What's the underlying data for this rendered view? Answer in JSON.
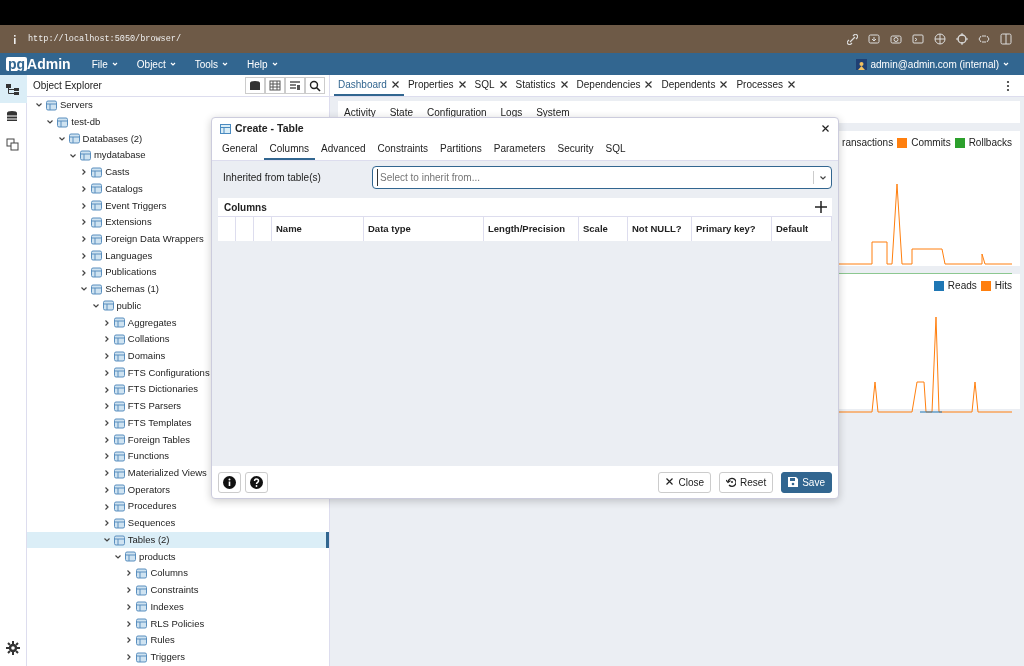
{
  "browser_bar": {
    "url": "http://localhost:5050/browser/"
  },
  "app": {
    "logo_prefix": "pg",
    "logo_rest": "Admin",
    "menus": [
      {
        "label": "File"
      },
      {
        "label": "Object"
      },
      {
        "label": "Tools"
      },
      {
        "label": "Help"
      }
    ],
    "user": "admin@admin.com (internal)"
  },
  "object_explorer": {
    "title": "Object Explorer",
    "tree": [
      {
        "label": "Servers",
        "expanded": true,
        "selected": false,
        "children": [
          {
            "label": "test-db",
            "expanded": true,
            "selected": false,
            "children": [
              {
                "label": "Databases (2)",
                "expanded": true,
                "selected": false,
                "children": [
                  {
                    "label": "mydatabase",
                    "expanded": true,
                    "selected": false,
                    "children": [
                      {
                        "label": "Casts",
                        "expanded": false,
                        "selected": false
                      },
                      {
                        "label": "Catalogs",
                        "expanded": false,
                        "selected": false
                      },
                      {
                        "label": "Event Triggers",
                        "expanded": false,
                        "selected": false
                      },
                      {
                        "label": "Extensions",
                        "expanded": false,
                        "selected": false
                      },
                      {
                        "label": "Foreign Data Wrappers",
                        "expanded": false,
                        "selected": false
                      },
                      {
                        "label": "Languages",
                        "expanded": false,
                        "selected": false
                      },
                      {
                        "label": "Publications",
                        "expanded": false,
                        "selected": false
                      },
                      {
                        "label": "Schemas (1)",
                        "expanded": true,
                        "selected": false,
                        "children": [
                          {
                            "label": "public",
                            "expanded": true,
                            "selected": false,
                            "children": [
                              {
                                "label": "Aggregates",
                                "expanded": false,
                                "selected": false
                              },
                              {
                                "label": "Collations",
                                "expanded": false,
                                "selected": false
                              },
                              {
                                "label": "Domains",
                                "expanded": false,
                                "selected": false
                              },
                              {
                                "label": "FTS Configurations",
                                "expanded": false,
                                "selected": false
                              },
                              {
                                "label": "FTS Dictionaries",
                                "expanded": false,
                                "selected": false
                              },
                              {
                                "label": "FTS Parsers",
                                "expanded": false,
                                "selected": false
                              },
                              {
                                "label": "FTS Templates",
                                "expanded": false,
                                "selected": false
                              },
                              {
                                "label": "Foreign Tables",
                                "expanded": false,
                                "selected": false
                              },
                              {
                                "label": "Functions",
                                "expanded": false,
                                "selected": false
                              },
                              {
                                "label": "Materialized Views",
                                "expanded": false,
                                "selected": false
                              },
                              {
                                "label": "Operators",
                                "expanded": false,
                                "selected": false
                              },
                              {
                                "label": "Procedures",
                                "expanded": false,
                                "selected": false
                              },
                              {
                                "label": "Sequences",
                                "expanded": false,
                                "selected": false
                              },
                              {
                                "label": "Tables (2)",
                                "expanded": true,
                                "selected": true,
                                "children": [
                                  {
                                    "label": "products",
                                    "expanded": true,
                                    "selected": false,
                                    "children": [
                                      {
                                        "label": "Columns",
                                        "expanded": false,
                                        "selected": false
                                      },
                                      {
                                        "label": "Constraints",
                                        "expanded": false,
                                        "selected": false
                                      },
                                      {
                                        "label": "Indexes",
                                        "expanded": false,
                                        "selected": false
                                      },
                                      {
                                        "label": "RLS Policies",
                                        "expanded": false,
                                        "selected": false
                                      },
                                      {
                                        "label": "Rules",
                                        "expanded": false,
                                        "selected": false
                                      },
                                      {
                                        "label": "Triggers",
                                        "expanded": false,
                                        "selected": false
                                      }
                                    ]
                                  }
                                ]
                              }
                            ]
                          }
                        ]
                      }
                    ]
                  }
                ]
              }
            ]
          }
        ]
      }
    ]
  },
  "main_tabs": [
    {
      "label": "Dashboard",
      "selected": true
    },
    {
      "label": "Properties",
      "selected": false
    },
    {
      "label": "SQL",
      "selected": false
    },
    {
      "label": "Statistics",
      "selected": false
    },
    {
      "label": "Dependencies",
      "selected": false
    },
    {
      "label": "Dependents",
      "selected": false
    },
    {
      "label": "Processes",
      "selected": false
    }
  ],
  "dashboard_subtabs": [
    {
      "label": "Activity"
    },
    {
      "label": "State"
    },
    {
      "label": "Configuration"
    },
    {
      "label": "Logs"
    },
    {
      "label": "System"
    }
  ],
  "charts": [
    {
      "legend": [
        {
          "label": "ransactions"
        },
        {
          "label": "Commits",
          "color": "#ff7f0e"
        },
        {
          "label": "Rollbacks",
          "color": "#2ca02c"
        }
      ]
    },
    {
      "legend": [
        {
          "label": "Reads",
          "color": "#1f77b4"
        },
        {
          "label": "Hits",
          "color": "#ff7f0e"
        }
      ]
    }
  ],
  "dialog": {
    "title": "Create - Table",
    "tabs": [
      {
        "label": "General",
        "selected": false
      },
      {
        "label": "Columns",
        "selected": true
      },
      {
        "label": "Advanced",
        "selected": false
      },
      {
        "label": "Constraints",
        "selected": false
      },
      {
        "label": "Partitions",
        "selected": false
      },
      {
        "label": "Parameters",
        "selected": false
      },
      {
        "label": "Security",
        "selected": false
      },
      {
        "label": "SQL",
        "selected": false
      }
    ],
    "field": {
      "label": "Inherited from table(s)",
      "placeholder": "Select to inherit from..."
    },
    "grid": {
      "title": "Columns",
      "columns": [
        "Name",
        "Data type",
        "Length/Precision",
        "Scale",
        "Not NULL?",
        "Primary key?",
        "Default"
      ]
    },
    "buttons": [
      {
        "label": "Close",
        "kind": "close"
      },
      {
        "label": "Reset",
        "kind": "reset"
      },
      {
        "label": "Save",
        "kind": "save"
      }
    ]
  }
}
